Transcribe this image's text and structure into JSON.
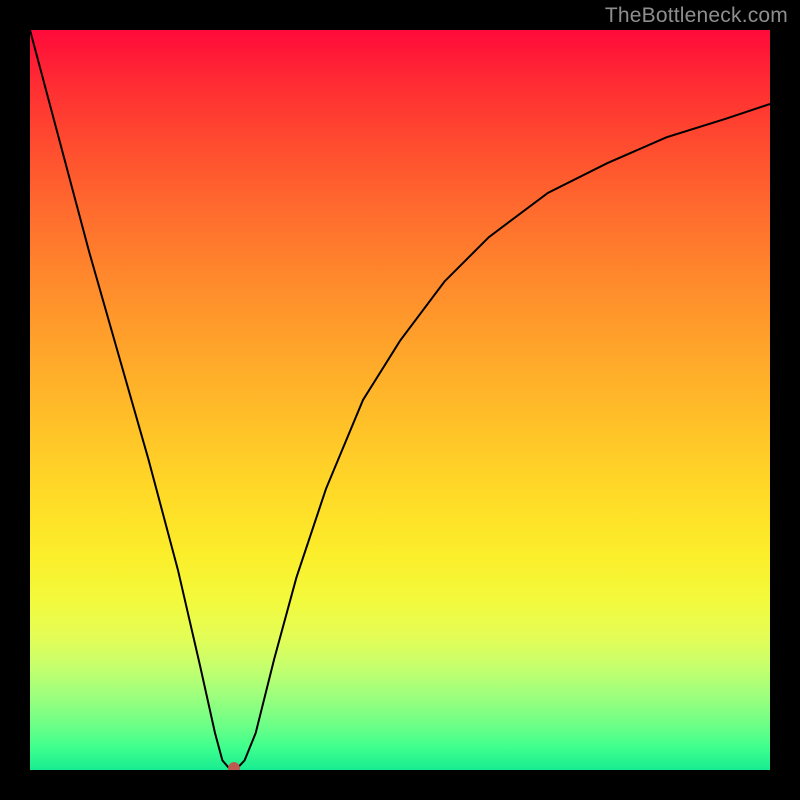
{
  "attribution": "TheBottleneck.com",
  "colors": {
    "frame": "#000000",
    "curve": "#000000",
    "marker": "#bb5a50",
    "attribution_text": "#8e8e8e"
  },
  "gradient_stops": [
    {
      "pct": 0,
      "hex": "#ff0a3a"
    },
    {
      "pct": 7,
      "hex": "#ff2b33"
    },
    {
      "pct": 15,
      "hex": "#ff4a2f"
    },
    {
      "pct": 24,
      "hex": "#ff6a2e"
    },
    {
      "pct": 34,
      "hex": "#ff8a2c"
    },
    {
      "pct": 44,
      "hex": "#ffa72a"
    },
    {
      "pct": 54,
      "hex": "#ffc328"
    },
    {
      "pct": 63,
      "hex": "#ffdb27"
    },
    {
      "pct": 71,
      "hex": "#fbee2a"
    },
    {
      "pct": 77,
      "hex": "#f3fa3c"
    },
    {
      "pct": 82,
      "hex": "#e4fd56"
    },
    {
      "pct": 86,
      "hex": "#c6ff6d"
    },
    {
      "pct": 90,
      "hex": "#9dff7d"
    },
    {
      "pct": 94,
      "hex": "#6cff87"
    },
    {
      "pct": 97,
      "hex": "#3eff8e"
    },
    {
      "pct": 100,
      "hex": "#18ec91"
    }
  ],
  "chart_data": {
    "type": "line",
    "title": "",
    "xlabel": "",
    "ylabel": "",
    "xlim": [
      0,
      100
    ],
    "ylim": [
      0,
      100
    ],
    "notes": "Background encodes bottleneck severity via a vertical gradient (green≈0, red≈100). Black curve shows bottleneck magnitude vs. some x. Minimum marked by a small reddish dot.",
    "series": [
      {
        "name": "bottleneck_curve",
        "points": [
          {
            "x": 0,
            "y": 100
          },
          {
            "x": 4,
            "y": 85
          },
          {
            "x": 8,
            "y": 70
          },
          {
            "x": 12,
            "y": 56
          },
          {
            "x": 16,
            "y": 42
          },
          {
            "x": 20,
            "y": 27
          },
          {
            "x": 23,
            "y": 14
          },
          {
            "x": 25,
            "y": 5
          },
          {
            "x": 26,
            "y": 1.3
          },
          {
            "x": 27,
            "y": 0.13
          },
          {
            "x": 27.9,
            "y": 0.13
          },
          {
            "x": 29,
            "y": 1.3
          },
          {
            "x": 30.5,
            "y": 5
          },
          {
            "x": 33,
            "y": 15
          },
          {
            "x": 36,
            "y": 26
          },
          {
            "x": 40,
            "y": 38
          },
          {
            "x": 45,
            "y": 50
          },
          {
            "x": 50,
            "y": 58
          },
          {
            "x": 56,
            "y": 66
          },
          {
            "x": 62,
            "y": 72
          },
          {
            "x": 70,
            "y": 78
          },
          {
            "x": 78,
            "y": 82
          },
          {
            "x": 86,
            "y": 85.5
          },
          {
            "x": 94,
            "y": 88
          },
          {
            "x": 100,
            "y": 90
          }
        ]
      }
    ],
    "marker": {
      "x": 27.5,
      "y": 0.13,
      "color": "#bb5a50"
    }
  }
}
